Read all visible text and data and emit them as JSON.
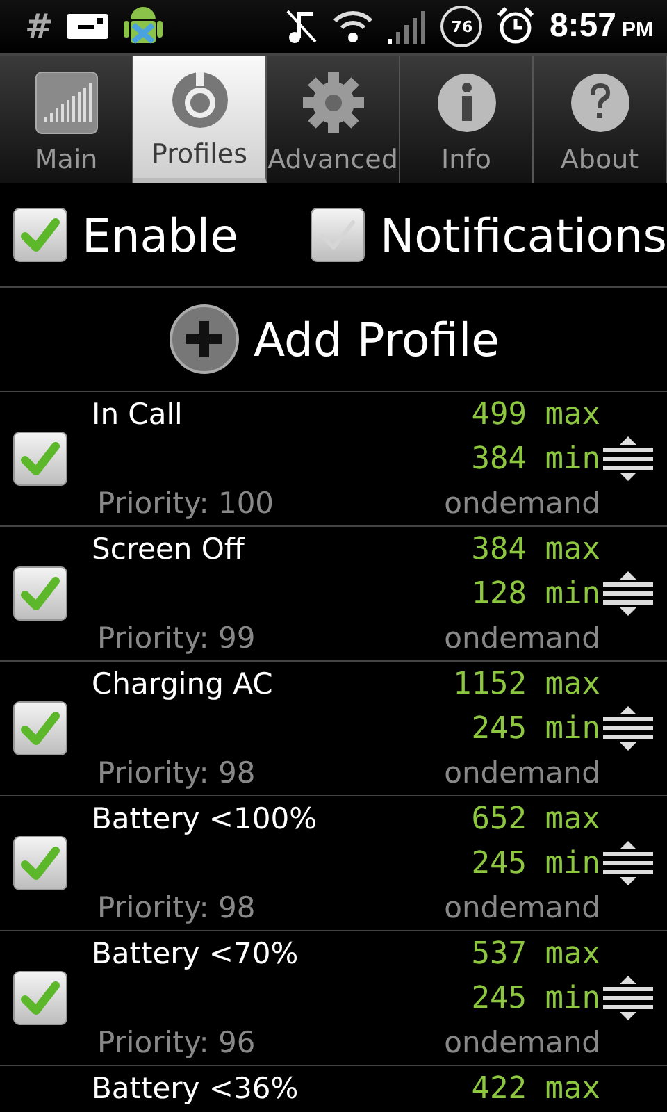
{
  "status_bar": {
    "left_symbol": "#",
    "battery": "76",
    "time": "8:57",
    "ampm": "PM"
  },
  "tabs": [
    {
      "label": "Main",
      "selected": false
    },
    {
      "label": "Profiles",
      "selected": true
    },
    {
      "label": "Advanced",
      "selected": false
    },
    {
      "label": "Info",
      "selected": false
    },
    {
      "label": "About",
      "selected": false
    }
  ],
  "options": [
    {
      "label": "Enable",
      "checked": true
    },
    {
      "label": "Notifications",
      "checked": false
    }
  ],
  "add_profile": {
    "label": "Add Profile"
  },
  "profiles": [
    {
      "name": "In Call",
      "max": "499 max",
      "min": "384 min",
      "priority": "Priority: 100",
      "governor": "ondemand",
      "checked": true
    },
    {
      "name": "Screen Off",
      "max": "384 max",
      "min": "128 min",
      "priority": "Priority: 99",
      "governor": "ondemand",
      "checked": true
    },
    {
      "name": "Charging AC",
      "max": "1152 max",
      "min": "245 min",
      "priority": "Priority: 98",
      "governor": "ondemand",
      "checked": true
    },
    {
      "name": "Battery <100%",
      "max": "652 max",
      "min": "245 min",
      "priority": "Priority: 98",
      "governor": "ondemand",
      "checked": true
    },
    {
      "name": "Battery <70%",
      "max": "537 max",
      "min": "245 min",
      "priority": "Priority: 96",
      "governor": "ondemand",
      "checked": true
    },
    {
      "name": "Battery <36%",
      "max": "422 max"
    }
  ]
}
